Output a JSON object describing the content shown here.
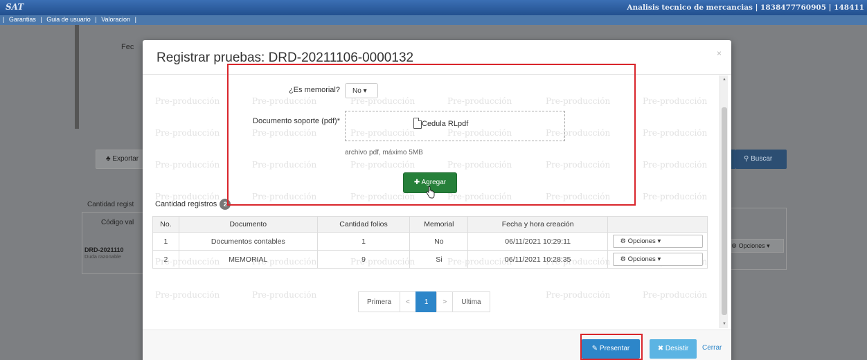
{
  "app": {
    "logo": "SAT",
    "title": "Analisis tecnico de mercancias | 1838477760905 | 148411"
  },
  "menu": {
    "items": [
      "Garantias",
      "Guia de usuario",
      "Valoracion"
    ],
    "separator": "|"
  },
  "background_page": {
    "fecha_label": "Fec",
    "export_label": "Exportar",
    "buscar_label": "Buscar",
    "cantidad_label": "Cantidad regist",
    "codigo_label": "Código val",
    "row_code": "DRD-2021110",
    "row_desc": "Duda razonable",
    "opciones_label": "Opciones"
  },
  "modal": {
    "title": "Registrar pruebas: DRD-20211106-0000132",
    "close_symbol": "×",
    "watermark": "Pre-producción",
    "form": {
      "es_memorial_label": "¿Es memorial?",
      "es_memorial_value": "No",
      "documento_label": "Documento soporte (pdf)*",
      "file_name": "Cedula RLpdf",
      "help_text": "archivo pdf, máximo 5MB",
      "agregar_label": "Agregar"
    },
    "registros": {
      "label": "Cantidad registros",
      "count": "2",
      "columns": [
        "No.",
        "Documento",
        "Cantidad folios",
        "Memorial",
        "Fecha y hora creación",
        ""
      ],
      "rows": [
        {
          "no": "1",
          "documento": "Documentos contables",
          "folios": "1",
          "memorial": "No",
          "fecha": "06/11/2021 10:29:11",
          "opciones": "Opciones"
        },
        {
          "no": "2",
          "documento": "MEMORIAL",
          "folios": "9",
          "memorial": "Si",
          "fecha": "06/11/2021 10:28:35",
          "opciones": "Opciones"
        }
      ]
    },
    "pagination": {
      "first": "Primera",
      "prev": "<",
      "current": "1",
      "next": ">",
      "last": "Ultima"
    },
    "footer": {
      "presentar_label": "Presentar",
      "desistir_label": "Desistir",
      "cerrar_label": "Cerrar"
    }
  },
  "colors": {
    "topbar": "#22508f",
    "primary_button": "#2d86c9",
    "success_button": "#26803a",
    "highlight": "#d9252b"
  }
}
